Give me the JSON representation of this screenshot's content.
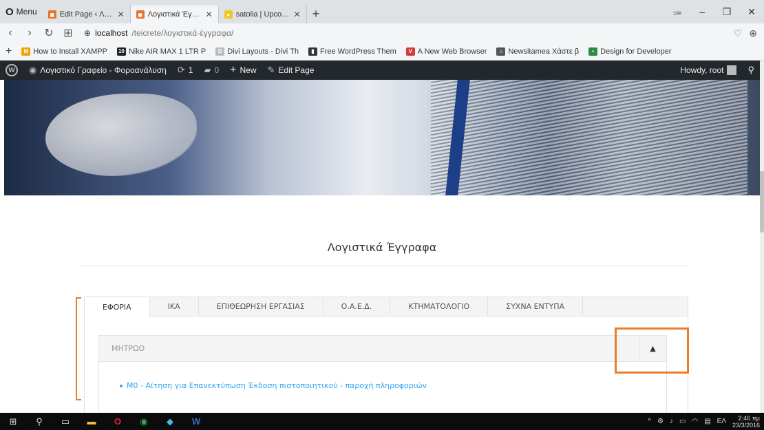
{
  "browser": {
    "menu_label": "Menu",
    "tabs": [
      {
        "title": "Edit Page ‹ Λογιστικό Γραφ",
        "close": "✕"
      },
      {
        "title": "Λογιστικά Έγγραφα – Λογ",
        "close": "✕"
      },
      {
        "title": "satolia | Upcoming Events",
        "close": "✕"
      }
    ],
    "new_tab": "+",
    "window_controls": [
      "⩴",
      "–",
      "❐",
      "✕"
    ],
    "url_host": "localhost",
    "url_path": "/teicrete/λογιστικά-έγγραφα/"
  },
  "bookmarks": [
    {
      "label": "How to Install XAMPP",
      "icon": "xampp-icon",
      "color": "#f0a500"
    },
    {
      "label": "Nike AIR MAX 1 LTR P",
      "icon": "nike-icon",
      "color": "#222222"
    },
    {
      "label": "Divi Layouts - Divi Th",
      "icon": "divi-icon",
      "color": "#bbbbbb"
    },
    {
      "label": "Free WordPress Them",
      "icon": "document-icon",
      "color": "#333333"
    },
    {
      "label": "A New Web Browser",
      "icon": "vivaldi-icon",
      "color": "#d63b3b"
    },
    {
      "label": "Newsitamea Χάστε β",
      "icon": "home-icon",
      "color": "#333333"
    },
    {
      "label": "Design for Developer",
      "icon": "design-icon",
      "color": "#2f8a4a"
    }
  ],
  "wpbar": {
    "site_name": "Λογιστικό Γραφείο - Φοροανάλυση",
    "updates": "1",
    "comments": "0",
    "new_label": "New",
    "edit_label": "Edit Page",
    "howdy": "Howdy, root"
  },
  "page": {
    "title": "Λογιστικά Έγγραφα",
    "tabs": [
      "ΕΦΟΡΙΑ",
      "ΙΚΑ",
      "ΕΠΙΘΕΩΡΗΣΗ ΕΡΓΑΣΙΑΣ",
      "Ο.Α.Ε.Δ.",
      "ΚΤΗΜΑΤΟΛΟΓΙΟ",
      "ΣΥΧΝΑ ΕΝΤΥΠΑ"
    ],
    "active_tab": "ΕΦΟΡΙΑ",
    "accordion_title": "ΜΗΤΡΩΟ",
    "accordion_toggle": "^",
    "doc_link": "Μ0 - Αίτηση για Επανεκτύπωση Έκδοση πιστοποιητικού - παροχή πληροφοριών"
  },
  "colors": {
    "link": "#2ea3f2",
    "annotation": "#e87d2c",
    "admin_bar": "#23282d"
  },
  "taskbar": {
    "lang": "ΕΛ",
    "time": "2:46 πμ",
    "date": "23/3/2016"
  }
}
